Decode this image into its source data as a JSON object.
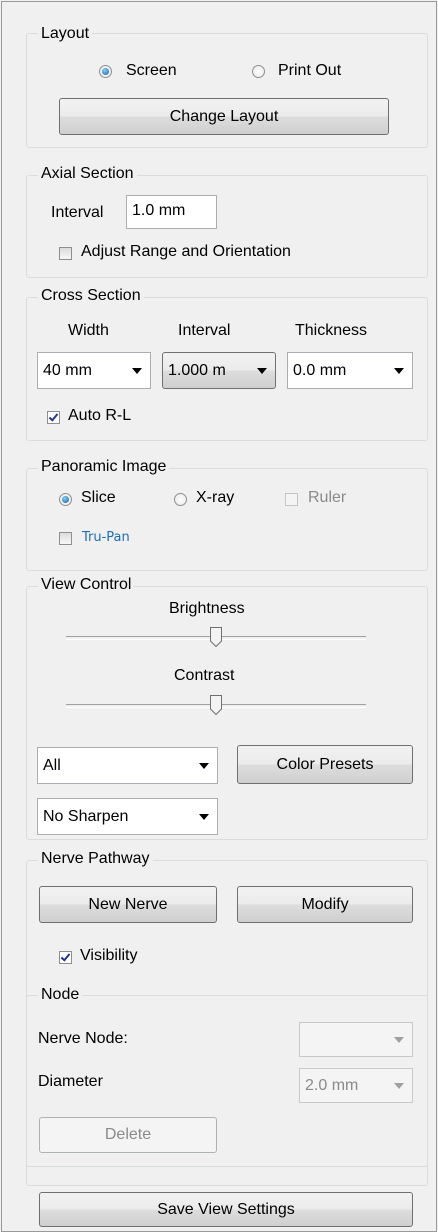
{
  "layout": {
    "title": "Layout",
    "screen_label": "Screen",
    "printout_label": "Print Out",
    "selected": "Screen",
    "change_button": "Change Layout"
  },
  "axial": {
    "title": "Axial Section",
    "interval_label": "Interval",
    "interval_value": "1.0 mm",
    "adjust_label": "Adjust Range and Orientation",
    "adjust_checked": false
  },
  "cross": {
    "title": "Cross Section",
    "width_label": "Width",
    "interval_label": "Interval",
    "thickness_label": "Thickness",
    "width_value": "40 mm",
    "interval_value": "1.000 m",
    "thickness_value": "0.0 mm",
    "auto_rl_label": "Auto R-L",
    "auto_rl_checked": true
  },
  "panoramic": {
    "title": "Panoramic Image",
    "slice_label": "Slice",
    "xray_label": "X-ray",
    "ruler_label": "Ruler",
    "selected": "Slice",
    "trupan_label": "Tru-Pan"
  },
  "view_control": {
    "title": "View Control",
    "brightness_label": "Brightness",
    "contrast_label": "Contrast",
    "brightness_level": 0.5,
    "contrast_level": 0.5,
    "filter_value": "All",
    "color_presets_button": "Color Presets",
    "sharpen_value": "No Sharpen"
  },
  "nerve": {
    "title": "Nerve Pathway",
    "new_button": "New Nerve",
    "modify_button": "Modify",
    "visibility_label": "Visibility",
    "visibility_checked": true,
    "node_title": "Node",
    "nerve_node_label": "Nerve Node:",
    "nerve_node_value": "",
    "diameter_label": "Diameter",
    "diameter_value": "2.0 mm",
    "delete_button": "Delete"
  },
  "save_button": "Save View Settings",
  "colors": {
    "panel_bg": "#f0f0f0",
    "group_border": "#dcdcdc",
    "radio_selected": "#2b7fc2",
    "checkmark": "#21398a",
    "trupan_blue": "#1c6fb3"
  }
}
